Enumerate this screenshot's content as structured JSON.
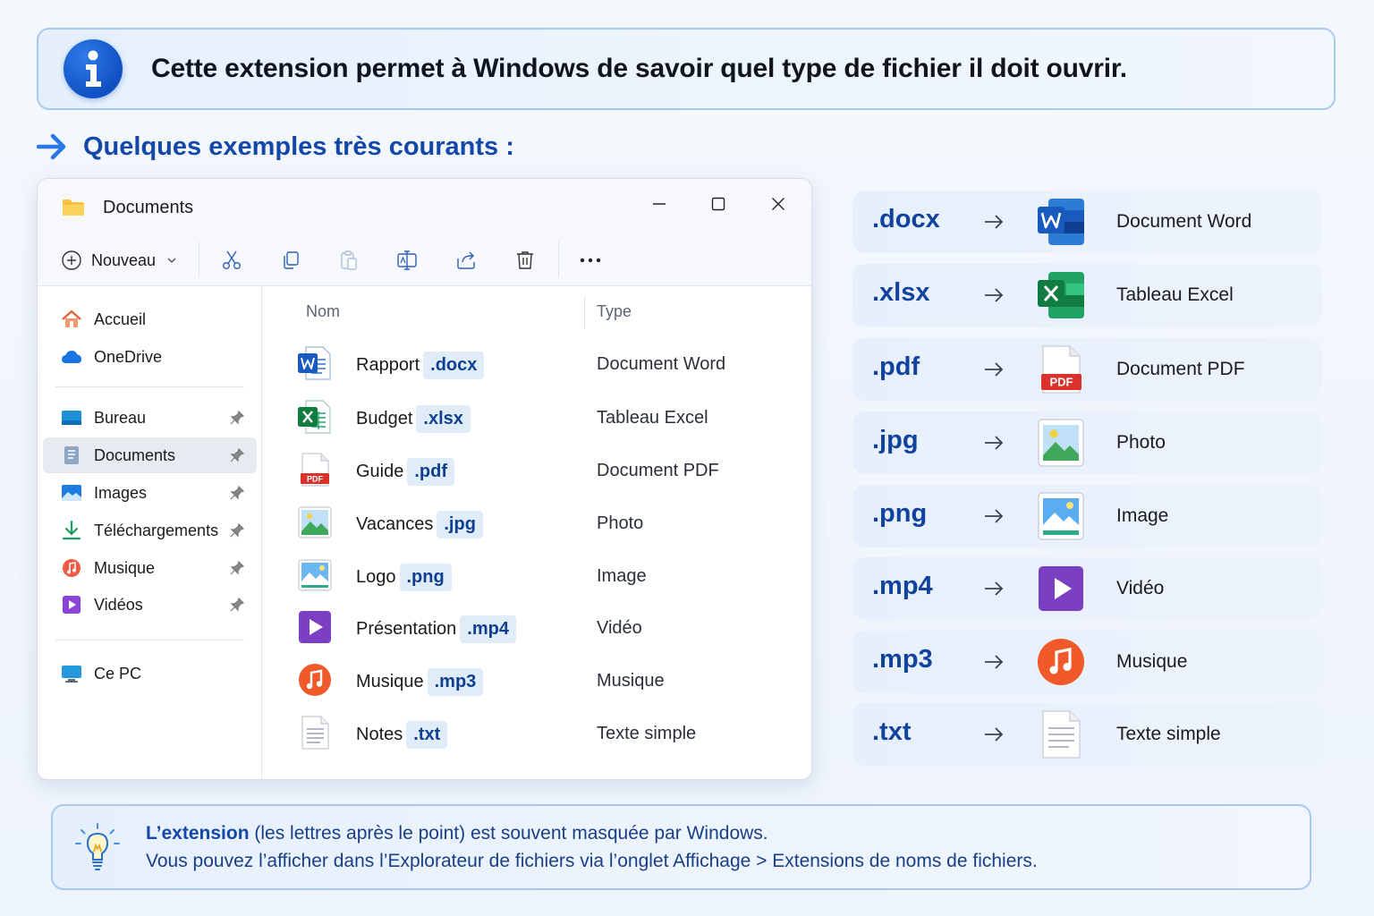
{
  "banner": {
    "text": "Cette extension permet à Windows de savoir quel type de fichier il doit ouvrir.",
    "icon": "info-icon"
  },
  "section": {
    "title": "Quelques exemples très courants :"
  },
  "window": {
    "title": "Documents",
    "toolbar": {
      "new_label": "Nouveau",
      "tools": [
        "cut-icon",
        "copy-icon",
        "paste-icon",
        "rename-icon",
        "share-icon",
        "delete-icon",
        "more-icon"
      ]
    },
    "nav": {
      "items": [
        {
          "label": "Accueil",
          "icon": "home-icon"
        },
        {
          "label": "OneDrive",
          "icon": "cloud-icon"
        },
        {
          "label": "Bureau",
          "icon": "desktop-icon",
          "pinned": true
        },
        {
          "label": "Documents",
          "icon": "documents-icon",
          "pinned": true,
          "active": true
        },
        {
          "label": "Images",
          "icon": "images-icon",
          "pinned": true
        },
        {
          "label": "Téléchargements",
          "icon": "download-icon",
          "pinned": true
        },
        {
          "label": "Musique",
          "icon": "music-icon",
          "pinned": true
        },
        {
          "label": "Vidéos",
          "icon": "videos-icon",
          "pinned": true
        },
        {
          "label": "Ce PC",
          "icon": "pc-icon"
        }
      ]
    },
    "columns": {
      "name": "Nom",
      "type": "Type"
    },
    "files": [
      {
        "base": "Rapport",
        "ext": ".docx",
        "type": "Document Word",
        "icon": "word-icon"
      },
      {
        "base": "Budget",
        "ext": ".xlsx",
        "type": "Tableau Excel",
        "icon": "excel-icon"
      },
      {
        "base": "Guide",
        "ext": ".pdf",
        "type": "Document PDF",
        "icon": "pdf-icon"
      },
      {
        "base": "Vacances",
        "ext": ".jpg",
        "type": "Photo",
        "icon": "photo-icon"
      },
      {
        "base": "Logo",
        "ext": ".png",
        "type": "Image",
        "icon": "image-icon"
      },
      {
        "base": "Présentation",
        "ext": ".mp4",
        "type": "Vidéo",
        "icon": "video-icon"
      },
      {
        "base": "Musique",
        "ext": ".mp3",
        "type": "Musique",
        "icon": "music-icon"
      },
      {
        "base": "Notes",
        "ext": ".txt",
        "type": "Texte simple",
        "icon": "text-icon"
      }
    ],
    "pdf_badge": "PDF"
  },
  "mapping": [
    {
      "ext": ".docx",
      "label": "Document Word",
      "icon": "word-icon"
    },
    {
      "ext": ".xlsx",
      "label": "Tableau Excel",
      "icon": "excel-icon"
    },
    {
      "ext": ".pdf",
      "label": "Document PDF",
      "icon": "pdf-icon"
    },
    {
      "ext": ".jpg",
      "label": "Photo",
      "icon": "photo-icon"
    },
    {
      "ext": ".png",
      "label": "Image",
      "icon": "image-icon"
    },
    {
      "ext": ".mp4",
      "label": "Vidéo",
      "icon": "video-icon"
    },
    {
      "ext": ".mp3",
      "label": "Musique",
      "icon": "music-icon"
    },
    {
      "ext": ".txt",
      "label": "Texte simple",
      "icon": "text-icon"
    }
  ],
  "tip": {
    "bold": "L’extension",
    "line1_rest": " (les lettres après le point) est souvent masquée par Windows.",
    "line2": "Vous pouvez l’afficher dans l’Explorateur de fichiers via l’onglet Affichage > Extensions de noms de fichiers.",
    "icon": "lightbulb-icon"
  },
  "colors": {
    "accent": "#1448a8",
    "extension_text": "#11439e",
    "word": "#185abd",
    "excel": "#107c41",
    "pdf": "#d8322b",
    "video": "#7b3fc4",
    "music": "#f05a2a"
  }
}
